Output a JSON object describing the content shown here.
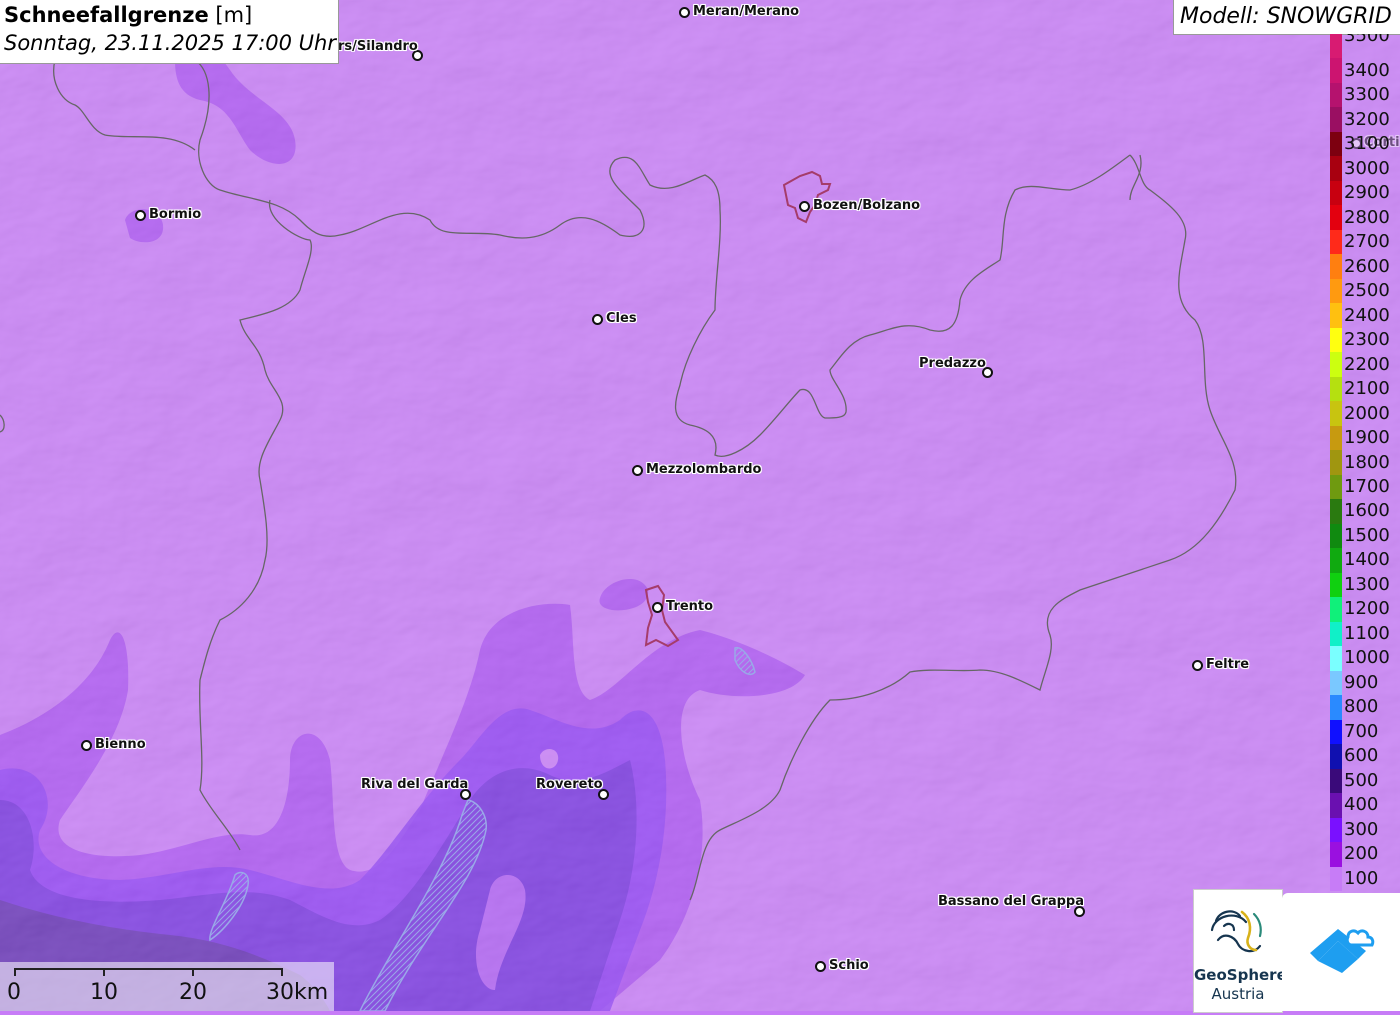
{
  "header": {
    "title_bold": "Schneefallgrenze",
    "title_unit": "[m]",
    "subtitle": "Sonntag, 23.11.2025 17:00 Uhr"
  },
  "model": {
    "label": "Modell: SNOWGRID"
  },
  "places": [
    {
      "name": "Meran/Merano",
      "key": "meran"
    },
    {
      "name": "rs/Silandro",
      "key": "silandro"
    },
    {
      "name": "Bozen/Bolzano",
      "key": "bozen"
    },
    {
      "name": "Bormio",
      "key": "bormio"
    },
    {
      "name": "Cles",
      "key": "cles"
    },
    {
      "name": "Predazzo",
      "key": "predazzo"
    },
    {
      "name": "Mezzolombardo",
      "key": "mezzolombardo"
    },
    {
      "name": "Trento",
      "key": "trento"
    },
    {
      "name": "Feltre",
      "key": "feltre"
    },
    {
      "name": "Bienno",
      "key": "bienno"
    },
    {
      "name": "Riva del Garda",
      "key": "riva"
    },
    {
      "name": "Rovereto",
      "key": "rovereto"
    },
    {
      "name": "Bassano del Grappa",
      "key": "bassano"
    },
    {
      "name": "Schio",
      "key": "schio"
    },
    {
      "name": "Corti",
      "key": "corti"
    }
  ],
  "legend": {
    "entries": [
      {
        "label": "3500",
        "color": "#d81b72"
      },
      {
        "label": "3400",
        "color": "#cc1470"
      },
      {
        "label": "3300",
        "color": "#b5126e"
      },
      {
        "label": "3200",
        "color": "#9a0f62"
      },
      {
        "label": "3100",
        "color": "#7d0010"
      },
      {
        "label": "3000",
        "color": "#a80010"
      },
      {
        "label": "2900",
        "color": "#c80010"
      },
      {
        "label": "2800",
        "color": "#e3000f"
      },
      {
        "label": "2700",
        "color": "#ff2a1a"
      },
      {
        "label": "2600",
        "color": "#ff7f10"
      },
      {
        "label": "2500",
        "color": "#ff9a10"
      },
      {
        "label": "2400",
        "color": "#ffc010"
      },
      {
        "label": "2300",
        "color": "#ffff10"
      },
      {
        "label": "2200",
        "color": "#ccff10"
      },
      {
        "label": "2100",
        "color": "#b5e010"
      },
      {
        "label": "2000",
        "color": "#c8c410"
      },
      {
        "label": "1900",
        "color": "#c79a10"
      },
      {
        "label": "1800",
        "color": "#a09610"
      },
      {
        "label": "1700",
        "color": "#6f9a10"
      },
      {
        "label": "1600",
        "color": "#2a7a10"
      },
      {
        "label": "1500",
        "color": "#108a10"
      },
      {
        "label": "1400",
        "color": "#10aa10"
      },
      {
        "label": "1300",
        "color": "#10d010"
      },
      {
        "label": "1200",
        "color": "#10f07a"
      },
      {
        "label": "1100",
        "color": "#10f0c8"
      },
      {
        "label": "1000",
        "color": "#7affff"
      },
      {
        "label": "900",
        "color": "#7ac8ff"
      },
      {
        "label": "800",
        "color": "#2a8aff"
      },
      {
        "label": "700",
        "color": "#1010ff"
      },
      {
        "label": "600",
        "color": "#1010b0"
      },
      {
        "label": "500",
        "color": "#3a0a7a"
      },
      {
        "label": "400",
        "color": "#6a10b0"
      },
      {
        "label": "300",
        "color": "#7a10ff"
      },
      {
        "label": "200",
        "color": "#9a10e0"
      },
      {
        "label": "100",
        "color": "#c77cf7"
      }
    ]
  },
  "scale": {
    "labels": [
      "0",
      "10",
      "20",
      "30km"
    ]
  },
  "logos": {
    "geosphere_line1": "GeoSphere",
    "geosphere_line2": "Austria"
  },
  "colors": {
    "background": "#c77cf7",
    "band_200": "#a74af0",
    "band_300": "#8a3cf3",
    "band_400": "#6d2fd8",
    "band_500": "#50308a",
    "border": "#555555"
  }
}
